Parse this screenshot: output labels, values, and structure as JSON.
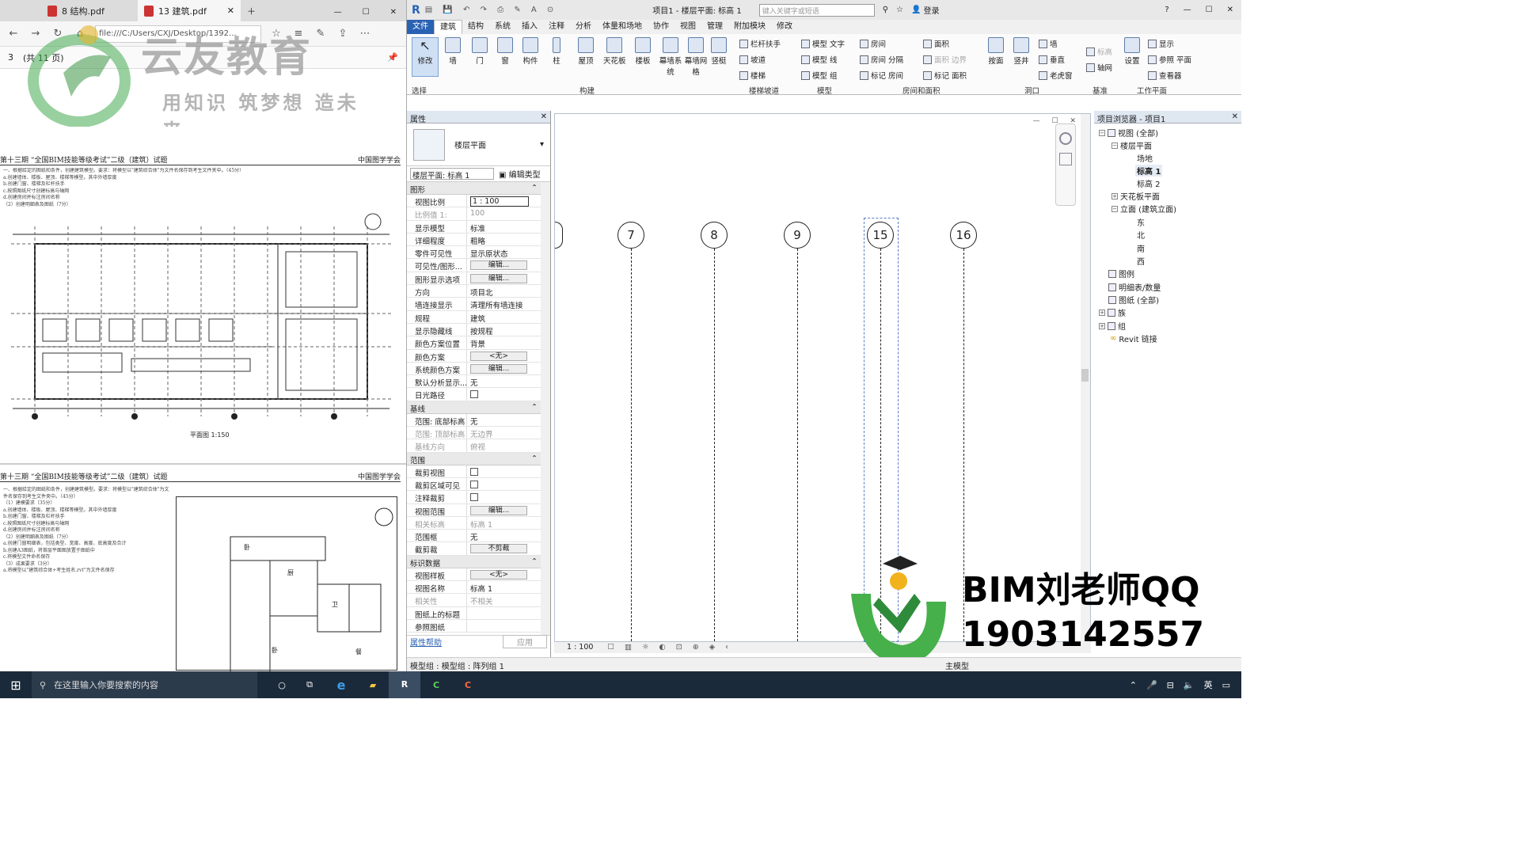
{
  "pdf": {
    "tabs": [
      "8 结构.pdf",
      "13 建筑.pdf"
    ],
    "address": "file:///C:/Users/CXJ/Desktop/1392...",
    "page_number": "3",
    "page_total": "(共 11 页)",
    "watermark_logo": "云友教育",
    "watermark_slogan": "用知识 筑梦想 造未来",
    "exam_title": "第十三期 “全国BIM技能等级考试”二级（建筑）试题",
    "exam_org": "中国图学学会",
    "exam_title2": "第十三期 “全国BIM技能等级考试”二级（建筑）试题",
    "exam_org2": "中国图学学会",
    "plan_caption": "平面图 1:150",
    "exam_text_lines": [
      "一、根据给定的图纸和条件，创建建筑模型。要求：将模型以\"建筑综合体\"为文件名保存到考生文件夹中。（45分）",
      "（1）建模要求（35分）",
      "a.创建墙体、楼板、屋顶、楼梯等模型。其中外墙厚度",
      "b.创建门窗、楼梯及栏杆扶手",
      "c.按照图纸尺寸创建标高与轴网",
      "d.创建房间并标注房间名称",
      "（2）创建明细表及图纸（7分）",
      "a.创建门窗明细表，包括类型、宽度、高度、底高度及合计",
      "b.创建A3图纸，将首层平面图放置于图纸中",
      "c.将模型文件命名保存",
      "（3）成果要求（3分）",
      "a.将模型以\"建筑综合体+考生姓名.rvt\"为文件名保存"
    ],
    "room_labels": [
      "卧",
      "厨",
      "卫",
      "卧",
      "餐"
    ]
  },
  "revit": {
    "title": "项目1 - 楼层平面: 标高 1",
    "search_placeholder": "键入关键字或短语",
    "login": "登录",
    "ribbon_tabs": [
      "文件",
      "建筑",
      "结构",
      "系统",
      "插入",
      "注释",
      "分析",
      "体量和场地",
      "协作",
      "视图",
      "管理",
      "附加模块",
      "修改"
    ],
    "ribbon_buttons": [
      "修改",
      "墙",
      "门",
      "窗",
      "构件",
      "柱",
      "屋顶",
      "天花板",
      "楼板",
      "幕墙系统",
      "幕墙网格",
      "竖梃"
    ],
    "ribbon_small": [
      "栏杆扶手",
      "坡道",
      "楼梯",
      "模型 文字",
      "模型 线",
      "模型 组",
      "房间",
      "房间 分隔",
      "标记 房间",
      "面积",
      "面积 边界",
      "标记 面积",
      "墙",
      "垂直",
      "老虎窗",
      "标高",
      "轴网",
      "设置",
      "显示",
      "参照 平面",
      "查看器",
      "按面",
      "竖井"
    ],
    "ribbon_groups": [
      "选择",
      "构建",
      "楼梯坡道",
      "模型",
      "房间和面积",
      "洞口",
      "基准",
      "工作平面"
    ],
    "props_title": "属性",
    "props_type": "楼层平面",
    "props_view": "楼层平面: 标高 1",
    "edit_type": "编辑类型",
    "sec_graphics": "图形",
    "sec_base": "基线",
    "sec_range": "范围",
    "sec_id": "标识数据",
    "rows_graphics": [
      [
        "视图比例",
        "1 : 100"
      ],
      [
        "比例值 1:",
        "100"
      ],
      [
        "显示模型",
        "标准"
      ],
      [
        "详细程度",
        "粗略"
      ],
      [
        "零件可见性",
        "显示原状态"
      ],
      [
        "可见性/图形...",
        "编辑..."
      ],
      [
        "图形显示选项",
        "编辑..."
      ],
      [
        "方向",
        "项目北"
      ],
      [
        "墙连接显示",
        "清理所有墙连接"
      ],
      [
        "规程",
        "建筑"
      ],
      [
        "显示隐藏线",
        "按规程"
      ],
      [
        "颜色方案位置",
        "背景"
      ],
      [
        "颜色方案",
        "<无>"
      ],
      [
        "系统颜色方案",
        "编辑..."
      ],
      [
        "默认分析显示...",
        "无"
      ],
      [
        "日光路径",
        ""
      ]
    ],
    "rows_base": [
      [
        "范围: 底部标高",
        "无"
      ],
      [
        "范围: 顶部标高",
        "无边界"
      ],
      [
        "基线方向",
        "俯视"
      ]
    ],
    "rows_range": [
      [
        "裁剪视图",
        ""
      ],
      [
        "裁剪区域可见",
        ""
      ],
      [
        "注释裁剪",
        ""
      ],
      [
        "视图范围",
        "编辑..."
      ],
      [
        "相关标高",
        "标高 1"
      ],
      [
        "范围框",
        "无"
      ],
      [
        "截剪裁",
        "不剪裁"
      ]
    ],
    "rows_id": [
      [
        "视图样板",
        "<无>"
      ],
      [
        "视图名称",
        "标高 1"
      ],
      [
        "相关性",
        "不相关"
      ],
      [
        "图纸上的标题",
        ""
      ],
      [
        "参照图纸",
        ""
      ]
    ],
    "props_help": "属性帮助",
    "apply": "应用",
    "grid_labels": [
      "7",
      "8",
      "9",
      "15",
      "16"
    ],
    "view_scale": "1 : 100",
    "browser_title": "项目浏览器 - 项目1",
    "tree": [
      "视图 (全部)",
      "楼层平面",
      "场地",
      "标高 1",
      "标高 2",
      "天花板平面",
      "立面 (建筑立面)",
      "东",
      "北",
      "南",
      "西",
      "图例",
      "明细表/数量",
      "图纸 (全部)",
      "族",
      "组",
      "Revit 链接"
    ],
    "status": "模型组 : 模型组 : 阵列组 1",
    "status_model": "主模型",
    "watermark_line1": "BIM刘老师QQ",
    "watermark_line2": "1903142557"
  },
  "taskbar": {
    "search": "在这里输入你要搜索的内容",
    "lang": "英"
  }
}
